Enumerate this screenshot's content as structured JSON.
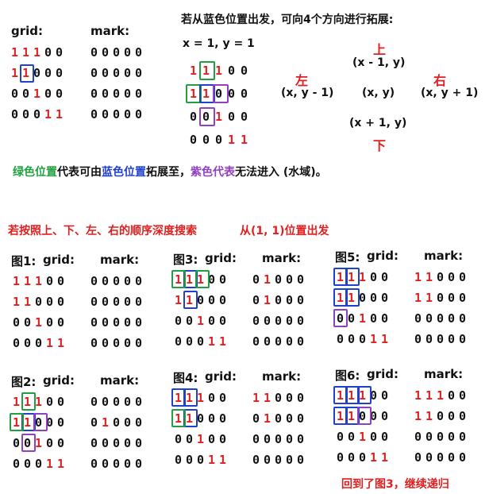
{
  "labels": {
    "grid": "grid:",
    "mark": "mark:"
  },
  "intro": {
    "title": "若从蓝色位置出发，可向4个方向进行拓展:",
    "xy": "x = 1, y = 1",
    "up": "上",
    "down": "下",
    "left": "左",
    "right": "右",
    "c_up": "(x - 1, y)",
    "c_center": "(x, y)",
    "c_down": "(x + 1, y)",
    "c_left": "(x, y - 1)",
    "c_right": "(x, y + 1)"
  },
  "legend": {
    "p1": "绿色位置",
    "p2": "代表可由",
    "p3": "蓝色位置",
    "p4": "拓展至，",
    "p5": "紫色代表",
    "p6": "无法进入 (水域)。"
  },
  "order": {
    "text": "若按照上、下、左、右的顺序深度搜索",
    "start": "从(1, 1)位置出发"
  },
  "figs": [
    {
      "title": "图1:",
      "grid": [
        "11100",
        "11000",
        "00100",
        "00011"
      ],
      "mark": [
        "00000",
        "00000",
        "00000",
        "00000"
      ]
    },
    {
      "title": "图2:",
      "grid": [
        "11100",
        "11000",
        "00100",
        "00011"
      ],
      "mark": [
        "00000",
        "01000",
        "00000",
        "00000"
      ]
    },
    {
      "title": "图3:",
      "grid": [
        "11100",
        "11000",
        "00100",
        "00011"
      ],
      "mark": [
        "01000",
        "01000",
        "00000",
        "00000"
      ]
    },
    {
      "title": "图4:",
      "grid": [
        "11100",
        "11000",
        "00100",
        "00011"
      ],
      "mark": [
        "11000",
        "01000",
        "00000",
        "00000"
      ]
    },
    {
      "title": "图5:",
      "grid": [
        "11100",
        "11000",
        "00100",
        "00011"
      ],
      "mark": [
        "11000",
        "11000",
        "00000",
        "00000"
      ]
    },
    {
      "title": "图6:",
      "grid": [
        "11100",
        "11000",
        "00100",
        "00011"
      ],
      "mark": [
        "11100",
        "11000",
        "00000",
        "00000"
      ]
    }
  ],
  "back": "回到了图3，继续递归",
  "top_grid": [
    "11100",
    "11000",
    "00100",
    "00011"
  ],
  "top_mark": [
    "00000",
    "00000",
    "00000",
    "00000"
  ],
  "diagram_grid": [
    "11100",
    "11000",
    "00100",
    "00011"
  ],
  "colors": {
    "blue": "#2040d0",
    "green": "#20a040",
    "purple": "#9040c0",
    "red": "#e02020"
  }
}
